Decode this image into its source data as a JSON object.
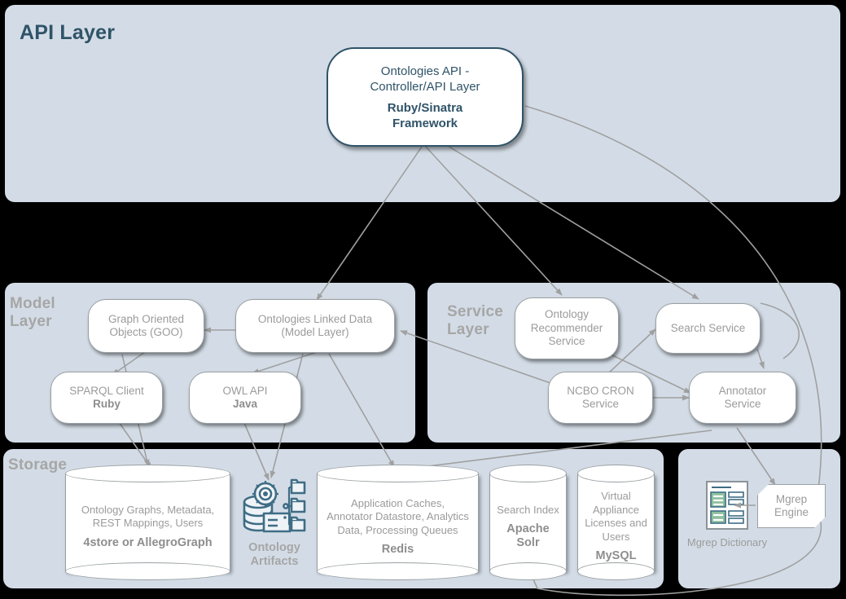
{
  "layers": {
    "api": {
      "label": "API Layer"
    },
    "model": {
      "label": "Model\nLayer",
      "line1": "Model",
      "line2": "Layer"
    },
    "service": {
      "label": "Service\nLayer",
      "line1": "Service",
      "line2": "Layer"
    },
    "storage": {
      "label": "Storage"
    }
  },
  "api_node": {
    "line1": "Ontologies API -",
    "line2": "Controller/API Layer",
    "bold1": "Ruby/Sinatra",
    "bold2": "Framework"
  },
  "model_nodes": [
    {
      "line1": "Graph Oriented",
      "line2": "Objects (GOO)",
      "bold": ""
    },
    {
      "line1": "Ontologies Linked Data",
      "line2": "(Model Layer)",
      "bold": ""
    },
    {
      "line1": "SPARQL Client",
      "line2": "",
      "bold": "Ruby"
    },
    {
      "line1": "OWL API",
      "line2": "",
      "bold": "Java"
    }
  ],
  "service_nodes": [
    {
      "line1": "Ontology",
      "line2": "Recommender",
      "line3": "Service"
    },
    {
      "line1": "Search Service",
      "line2": "",
      "line3": ""
    },
    {
      "line1": "NCBO CRON",
      "line2": "Service",
      "line3": ""
    },
    {
      "line1": "Annotator",
      "line2": "Service",
      "line3": ""
    }
  ],
  "storage_nodes": [
    {
      "lines": [
        "Ontology Graphs, Metadata,",
        "REST  Mappings, Users"
      ],
      "bold": "4store or AllegroGraph"
    },
    {
      "lines": [
        "Application Caches,",
        "Annotator Datastore, Analytics",
        "Data, Processing Queues"
      ],
      "bold": "Redis"
    },
    {
      "lines": [
        "Search Index"
      ],
      "bold": "Apache\nSolr",
      "bold1": "Apache",
      "bold2": "Solr"
    },
    {
      "lines": [
        "Virtual",
        "Appliance",
        "Licenses and",
        "Users"
      ],
      "bold": "MySQL"
    }
  ],
  "icons": {
    "ontology_artifacts": {
      "name": "ontology-artifacts-icon",
      "caption1": "Ontology",
      "caption2": "Artifacts"
    },
    "mgrep_dictionary": {
      "name": "mgrep-dictionary-icon",
      "caption": "Mgrep Dictionary"
    }
  },
  "mgrep_engine": {
    "line1": "Mgrep",
    "line2": "Engine"
  },
  "colors": {
    "panel": "#d3dce6",
    "background": "#000000",
    "api_accent": "#2f5368",
    "node_text": "#9b9b9b",
    "layer_label": "#a6a6a6",
    "connector": "#a0a0a0",
    "icon_stroke": "#3f6d85",
    "icon_fill": "#8fbf9f"
  }
}
